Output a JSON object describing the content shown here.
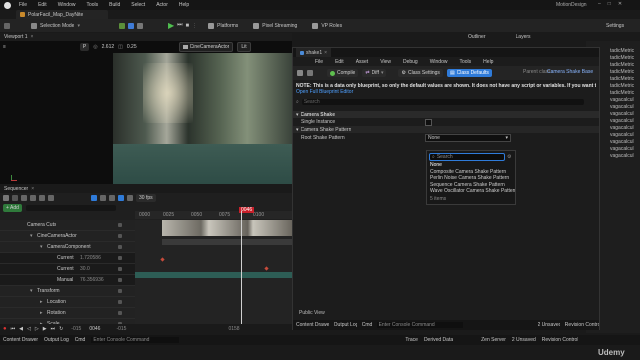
{
  "app": {
    "menu": [
      "File",
      "Edit",
      "Window",
      "Tools",
      "Build",
      "Select",
      "Actor",
      "Help"
    ],
    "project_tab": "PolarFacil_Map_DayNite",
    "account": "MotionDesign",
    "window_controls": [
      "–",
      "□",
      "✕"
    ]
  },
  "toolbar": {
    "mode": "Selection Mode",
    "platforms": "Platforms",
    "pixel_streaming": "Pixel Streaming",
    "vr_roles": "VP Roles",
    "settings": "Settings"
  },
  "viewport": {
    "tab": "Viewport 1",
    "fov_value": "2.612",
    "zoom_value": "0.25",
    "camera_label": "CineCameraActor",
    "lit_label": "Lit",
    "mode_short": "P"
  },
  "outliner": {
    "tab": "Outliner",
    "layers_tab": "Layers",
    "items": [
      "tadicMetric",
      "tadicMetric",
      "tadicMetric",
      "tadicMetric",
      "tadicMetric",
      "tadicMetric",
      "tadicMetric",
      "vagacalcul",
      "vagacalcul",
      "vagacalcul",
      "vagacalcul",
      "vagacalcul",
      "vagacalcul",
      "vagacalcul",
      "vagacalcul",
      "vagacalcul"
    ]
  },
  "sequencer": {
    "tab": "Sequencer",
    "add_label": "+ Add",
    "fps_label": "30 fps",
    "frame_current": "0046",
    "ruler_ticks": [
      "0000",
      "0025",
      "0050",
      "0075",
      "0100"
    ],
    "tracks": [
      {
        "label": "Camera Cuts",
        "value": "",
        "indent": 0,
        "expand": ""
      },
      {
        "label": "CineCameraActor",
        "value": "",
        "indent": 1,
        "expand": "▾"
      },
      {
        "label": "CameraComponent",
        "value": "",
        "indent": 2,
        "expand": "▾"
      },
      {
        "label": "Current",
        "value": "1.720586",
        "indent": 3,
        "expand": ""
      },
      {
        "label": "Current",
        "value": "30.0",
        "indent": 3,
        "expand": ""
      },
      {
        "label": "Manual",
        "value": "76.356936",
        "indent": 3,
        "expand": ""
      },
      {
        "label": "Transform",
        "value": "",
        "indent": 1,
        "expand": "▾"
      },
      {
        "label": "Location",
        "value": "",
        "indent": 2,
        "expand": "▸"
      },
      {
        "label": "Rotation",
        "value": "",
        "indent": 2,
        "expand": "▸"
      },
      {
        "label": "Scale",
        "value": "",
        "indent": 2,
        "expand": "▸"
      }
    ],
    "transport_start": "-015",
    "transport_current": "0046",
    "range_start": "-015",
    "range_mid": "-015",
    "range_end": "0158",
    "range_end2": "0158"
  },
  "blueprint": {
    "tab": "shake1",
    "menu": [
      "File",
      "Edit",
      "Asset",
      "View",
      "Debug",
      "Window",
      "Tools",
      "Help"
    ],
    "compile": "Compile",
    "diff": "Diff",
    "class_settings": "Class Settings",
    "class_defaults": "Class Defaults",
    "parent_class_label": "Parent class:",
    "parent_class_value": "Camera Shake Base",
    "note": "NOTE: This is a data only blueprint, so only the default values are shown.  It does not have any script or variables.  If you want to add some,",
    "note_link": "Open Full Blueprint Editor",
    "search_placeholder": "Search",
    "section_camera_shake": "Camera Shake",
    "single_instance_label": "Single Instance",
    "section_pattern": "Camera Shake Pattern",
    "root_pattern_label": "Root Shake Pattern",
    "root_pattern_value": "None",
    "public_view": "Public View",
    "dropdown": {
      "search_placeholder": "Search",
      "options": [
        "None",
        "Composite Camera Shake Pattern",
        "Perlin Noise Camera Shake Pattern",
        "Sequence Camera Shake Pattern",
        "Wave Oscillator Camera Shake Pattern"
      ],
      "count": "5 items"
    },
    "bottom": {
      "content_drawer": "Content Drawer",
      "output_log": "Output Log",
      "cmd": "Cmd",
      "console_placeholder": "Enter Console Command",
      "unsaved": "2 Unsaved",
      "revision": "Revision Control"
    }
  },
  "statusbar": {
    "content_drawer": "Content Drawer",
    "output_log": "Output Log",
    "cmd": "Cmd",
    "console_placeholder": "Enter Console Command",
    "trace": "Trace",
    "derived_data": "Derived Data",
    "zen_server": "Zen Server",
    "unsaved": "2 Unsaved",
    "revision": "Revision Control"
  },
  "watermark": "Udemy"
}
